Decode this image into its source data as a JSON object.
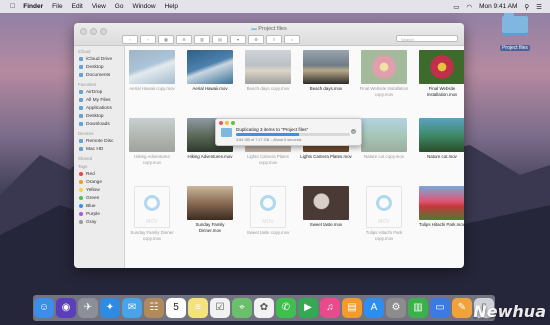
{
  "menubar": {
    "apple_icon": "apple-icon",
    "items": [
      "Finder",
      "File",
      "Edit",
      "View",
      "Go",
      "Window",
      "Help"
    ],
    "clock": "Mon 9:41 AM"
  },
  "desktop": {
    "folder_label": "Project files"
  },
  "window": {
    "title": "Project files",
    "search_placeholder": "Search",
    "sidebar": {
      "sections": [
        {
          "header": "iCloud",
          "items": [
            "iCloud Drive",
            "Desktop",
            "Documents"
          ]
        },
        {
          "header": "Favorites",
          "items": [
            "AirDrop",
            "All My Files",
            "Applications",
            "Desktop",
            "Downloads"
          ]
        },
        {
          "header": "Devices",
          "items": [
            "Remote Disc",
            "Mac HD"
          ]
        },
        {
          "header": "Shared",
          "items": []
        }
      ],
      "tags_header": "Tags",
      "tags": [
        {
          "name": "Red",
          "color": "#e64545"
        },
        {
          "name": "Orange",
          "color": "#f39c2b"
        },
        {
          "name": "Yellow",
          "color": "#f2d33c"
        },
        {
          "name": "Green",
          "color": "#4cc052"
        },
        {
          "name": "Blue",
          "color": "#3a8ee6"
        },
        {
          "name": "Purple",
          "color": "#a25ed0"
        },
        {
          "name": "Gray",
          "color": "#9a9a9a"
        }
      ]
    },
    "files": [
      {
        "name": "Aerial Hawaii copy.mov",
        "kind": "ocean",
        "copy": true
      },
      {
        "name": "Aerial Hawaii.mov",
        "kind": "ocean",
        "copy": false
      },
      {
        "name": "Beach days copy.mov",
        "kind": "beach",
        "copy": true
      },
      {
        "name": "Beach days.mov",
        "kind": "beach",
        "copy": false
      },
      {
        "name": "Final Website Installation copy.mov",
        "kind": "flower",
        "copy": true
      },
      {
        "name": "Final Website Installation.mov",
        "kind": "flower",
        "copy": false
      },
      {
        "name": "Hiking Adventures copy.mov",
        "kind": "hike",
        "copy": true
      },
      {
        "name": "Hiking Adventures.mov",
        "kind": "hike",
        "copy": false
      },
      {
        "name": "Lights Camera Plates copy.mov",
        "kind": "food",
        "copy": true
      },
      {
        "name": "Lights Camera Plates.mov",
        "kind": "food",
        "copy": false
      },
      {
        "name": "Nature cut copy.mov",
        "kind": "nature",
        "copy": true
      },
      {
        "name": "Nature cut.mov",
        "kind": "nature",
        "copy": false
      },
      {
        "name": "Sunday Family Dinner copy.mov",
        "kind": "qt",
        "copy": true
      },
      {
        "name": "Sunday Family Dinner.mov",
        "kind": "dinner",
        "copy": false
      },
      {
        "name": "Sweet taste copy.mov",
        "kind": "qt",
        "copy": true
      },
      {
        "name": "Sweet taste.mov",
        "kind": "sweet",
        "copy": false
      },
      {
        "name": "Tulips Hitachi Park copy.mov",
        "kind": "qt",
        "copy": true
      },
      {
        "name": "Tulips Hitachi Park.mov",
        "kind": "tulips",
        "copy": false
      }
    ],
    "qt_label": "MOV"
  },
  "progress": {
    "text": "Duplicating 3 items to \"Project files\"",
    "fraction": 0.55,
    "status": "3.64 GB of 7.17 GB – About 5 seconds"
  },
  "dock": {
    "icons": [
      "finder-icon",
      "siri-icon",
      "launchpad-icon",
      "safari-icon",
      "mail-icon",
      "contacts-icon",
      "calendar-icon",
      "notes-icon",
      "reminders-icon",
      "maps-icon",
      "photos-icon",
      "messages-icon",
      "facetime-icon",
      "itunes-icon",
      "ibooks-icon",
      "appstore-icon",
      "preferences-icon",
      "numbers-icon",
      "keynote-icon",
      "pages-icon",
      "trash-icon"
    ],
    "calendar_day": "5"
  },
  "watermark": "Newhua"
}
